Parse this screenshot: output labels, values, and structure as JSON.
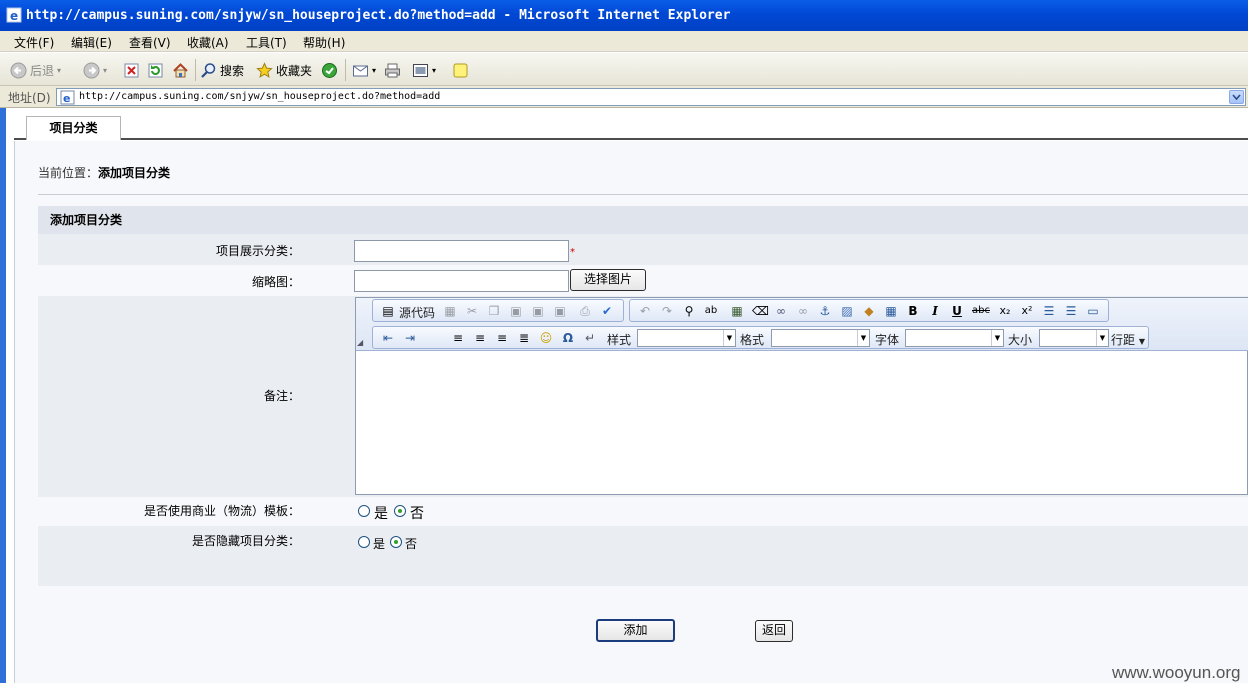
{
  "window": {
    "title": "http://campus.suning.com/snjyw/sn_houseproject.do?method=add - Microsoft Internet Explorer"
  },
  "menu": [
    "文件(F)",
    "编辑(E)",
    "查看(V)",
    "收藏(A)",
    "工具(T)",
    "帮助(H)"
  ],
  "toolbar": {
    "back_label": "后退",
    "search_label": "搜索",
    "favorites_label": "收藏夹"
  },
  "address": {
    "label": "地址(D)",
    "url": "http://campus.suning.com/snjyw/sn_houseproject.do?method=add"
  },
  "page": {
    "tab_label": "项目分类",
    "breadcrumb_prefix": "当前位置：",
    "breadcrumb_current": "添加项目分类",
    "section_title": "添加项目分类",
    "fields": {
      "category_label": "项目展示分类：",
      "category_value": "",
      "required_mark": "*",
      "thumb_label": "缩略图：",
      "thumb_value": "",
      "select_image_button": "选择图片",
      "notes_label": "备注：",
      "commercial_label": "是否使用商业（物流）模板：",
      "hidden_label": "是否隐藏项目分类："
    },
    "radio": {
      "yes": "是",
      "no": "否",
      "commercial_selected": "no",
      "hidden_selected": "no"
    },
    "buttons": {
      "add": "添加",
      "back": "返回"
    }
  },
  "editor": {
    "source_label": "源代码",
    "style_label": "样式",
    "format_label": "格式",
    "font_label": "字体",
    "size_label": "大小",
    "line_height_label": "行距",
    "style_value": "",
    "format_value": "",
    "font_value": "",
    "size_value": "",
    "content": ""
  },
  "watermark": "www.wooyun.org"
}
